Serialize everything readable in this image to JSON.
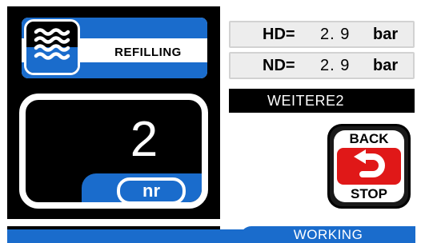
{
  "status": {
    "icon": "water-waves-icon",
    "label": "REFILLING"
  },
  "counter": {
    "value": "2",
    "unit": "nr"
  },
  "readouts": [
    {
      "label": "HD=",
      "value": "2. 9",
      "unit": "bar"
    },
    {
      "label": "ND=",
      "value": "2. 9",
      "unit": "bar"
    }
  ],
  "more_button": {
    "label": "WEITERE2"
  },
  "back_stop_button": {
    "top_label": "BACK",
    "bottom_label": "STOP",
    "icon": "return-arrow-icon"
  },
  "status_bar": {
    "text": "WORKING"
  },
  "colors": {
    "accent_blue": "#1a6ccc",
    "stop_red": "#e01818",
    "panel_black": "#000000",
    "readout_grey": "#ededed"
  }
}
